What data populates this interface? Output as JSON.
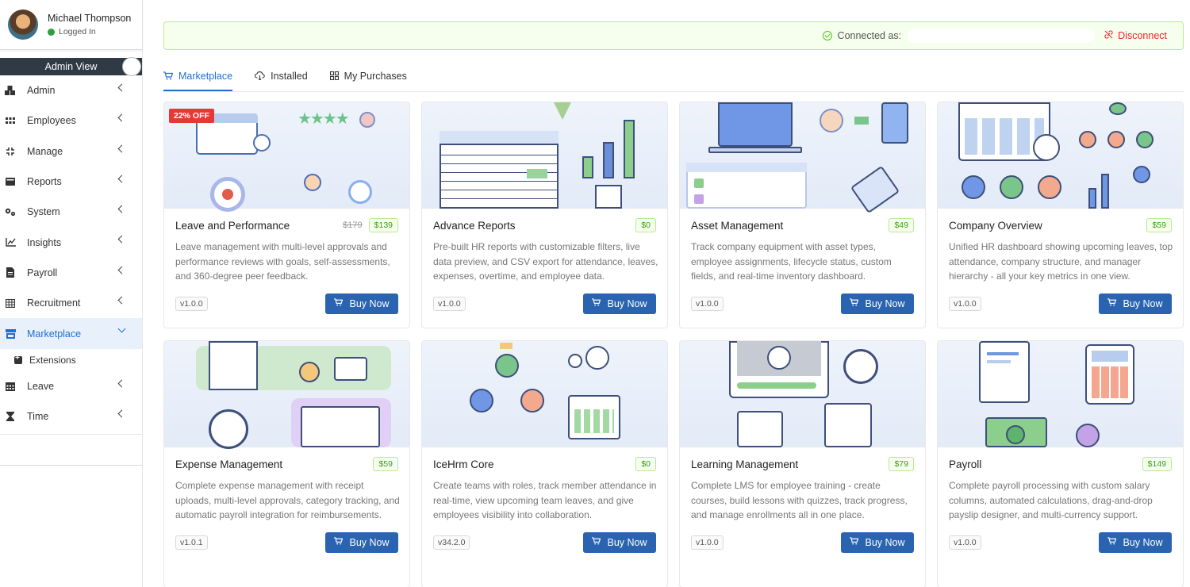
{
  "user": {
    "name": "Michael Thompson",
    "status": "Logged In"
  },
  "admin_view_label": "Admin View",
  "nav": [
    {
      "label": "Admin",
      "icon": "cubes-icon"
    },
    {
      "label": "Employees",
      "icon": "grid-dots-icon"
    },
    {
      "label": "Manage",
      "icon": "arrows-icon"
    },
    {
      "label": "Reports",
      "icon": "wallet-icon"
    },
    {
      "label": "System",
      "icon": "cogs-icon"
    },
    {
      "label": "Insights",
      "icon": "line-chart-icon"
    },
    {
      "label": "Payroll",
      "icon": "document-icon"
    },
    {
      "label": "Recruitment",
      "icon": "table-icon"
    },
    {
      "label": "Marketplace",
      "icon": "store-icon"
    },
    {
      "label": "Leave",
      "icon": "calendar-icon"
    },
    {
      "label": "Time",
      "icon": "hourglass-icon"
    }
  ],
  "sub_nav": {
    "label": "Extensions"
  },
  "connection": {
    "label": "Connected as:",
    "disconnect": "Disconnect"
  },
  "tabs": [
    {
      "label": "Marketplace"
    },
    {
      "label": "Installed"
    },
    {
      "label": "My Purchases"
    }
  ],
  "buy_label": "Buy Now",
  "cards": [
    {
      "title": "Leave and Performance",
      "old_price": "$179",
      "price": "$139",
      "discount": "22% OFF",
      "desc": "Leave management with multi-level approvals and performance reviews with goals, self-assessments, and 360-degree peer feedback.",
      "version": "v1.0.0"
    },
    {
      "title": "Advance Reports",
      "price": "$0",
      "desc": "Pre-built HR reports with customizable filters, live data preview, and CSV export for attendance, leaves, expenses, overtime, and employee data.",
      "version": "v1.0.0"
    },
    {
      "title": "Asset Management",
      "price": "$49",
      "desc": "Track company equipment with asset types, employee assignments, lifecycle status, custom fields, and real-time inventory dashboard.",
      "version": "v1.0.0"
    },
    {
      "title": "Company Overview",
      "price": "$59",
      "desc": "Unified HR dashboard showing upcoming leaves, top attendance, company structure, and manager hierarchy - all your key metrics in one view.",
      "version": "v1.0.0"
    },
    {
      "title": "Expense Management",
      "price": "$59",
      "desc": "Complete expense management with receipt uploads, multi-level approvals, category tracking, and automatic payroll integration for reimbursements.",
      "version": "v1.0.1"
    },
    {
      "title": "IceHrm Core",
      "price": "$0",
      "desc": "Create teams with roles, track member attendance in real-time, view upcoming team leaves, and give employees visibility into collaboration.",
      "version": "v34.2.0"
    },
    {
      "title": "Learning Management",
      "price": "$79",
      "desc": "Complete LMS for employee training - create courses, build lessons with quizzes, track progress, and manage enrollments all in one place.",
      "version": "v1.0.0"
    },
    {
      "title": "Payroll",
      "price": "$149",
      "desc": "Complete payroll processing with custom salary columns, automated calculations, drag-and-drop payslip designer, and multi-currency support.",
      "version": "v1.0.0"
    }
  ]
}
